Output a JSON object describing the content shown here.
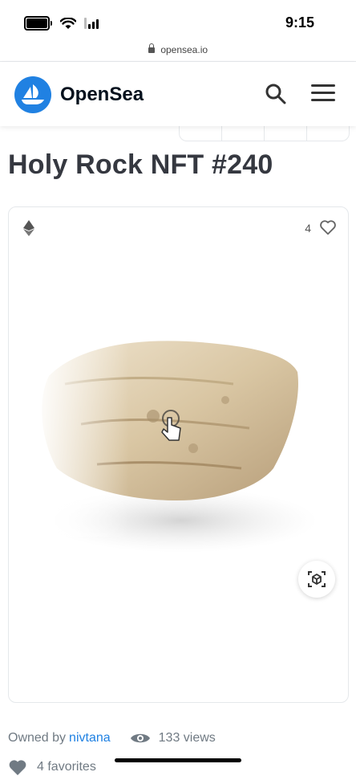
{
  "status_bar": {
    "time": "9:15"
  },
  "browser": {
    "url": "opensea.io"
  },
  "header": {
    "brand": "OpenSea"
  },
  "asset": {
    "title": "Holy Rock NFT #240",
    "favorites_count": "4",
    "owned_by_label": "Owned by",
    "owner": "nivtana",
    "views": "133 views",
    "favorites": "4 favorites"
  },
  "icons": {
    "battery": "battery-icon",
    "wifi": "wifi-icon",
    "signal": "signal-icon",
    "lock": "lock-icon",
    "logo": "opensea-boat-logo",
    "search": "search-icon",
    "menu": "hamburger-menu-icon",
    "chain": "ethereum-icon",
    "heart": "heart-outline-icon",
    "ar": "ar-cube-icon",
    "eye": "eye-icon",
    "favorite": "heart-filled-icon"
  },
  "colors": {
    "accent": "#2081e2",
    "text": "#353840",
    "muted": "#707a83"
  }
}
